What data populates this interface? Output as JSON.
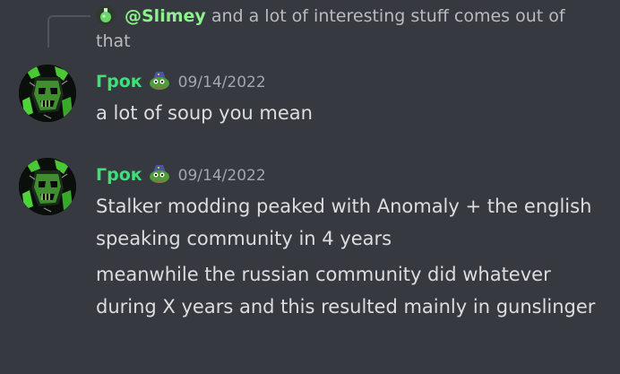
{
  "reply": {
    "mention": "@Slimey",
    "text": " and a lot of interesting stuff comes out of that"
  },
  "messages": [
    {
      "username": "Грок",
      "timestamp": "09/14/2022",
      "lines": [
        "a lot of soup you mean"
      ]
    },
    {
      "username": "Грок",
      "timestamp": "09/14/2022",
      "lines": [
        "Stalker modding peaked with Anomaly + the english speaking community in 4 years",
        "meanwhile the russian community did whatever during X years and this resulted mainly in gunslinger"
      ]
    }
  ],
  "icons": {
    "reply_avatar": "green-potion-icon",
    "user_avatar": "green-skull-avatar",
    "badge": "pepe-wizard-icon"
  },
  "colors": {
    "background": "#36393f",
    "username": "#3ee07a",
    "mention": "#8cf28c",
    "message_text": "#dcddde",
    "muted_text": "#a3a6aa"
  }
}
